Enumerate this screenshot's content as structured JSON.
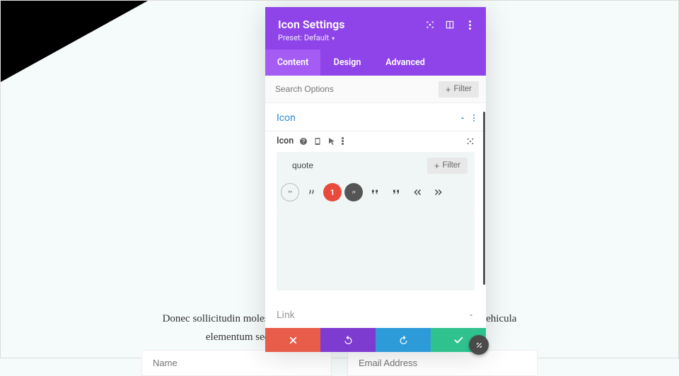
{
  "panel": {
    "title": "Icon Settings",
    "preset_label": "Preset: Default",
    "tabs": {
      "content": "Content",
      "design": "Design",
      "advanced": "Advanced"
    }
  },
  "search": {
    "placeholder": "Search Options",
    "filter_label": "Filter"
  },
  "section_icon": {
    "title": "Icon",
    "row_label": "Icon"
  },
  "picker": {
    "query": "quote",
    "filter_label": "Filter",
    "badge": "1"
  },
  "section_link": {
    "title": "Link"
  },
  "body_text": "Donec sollicitudin molestie malesuada. Vestibulum ac diam sit amet quam vehicula elementum sed sit amet dui. Pellentesque nec, egestas non nisi.",
  "form": {
    "name_placeholder": "Name",
    "email_placeholder": "Email Address"
  }
}
